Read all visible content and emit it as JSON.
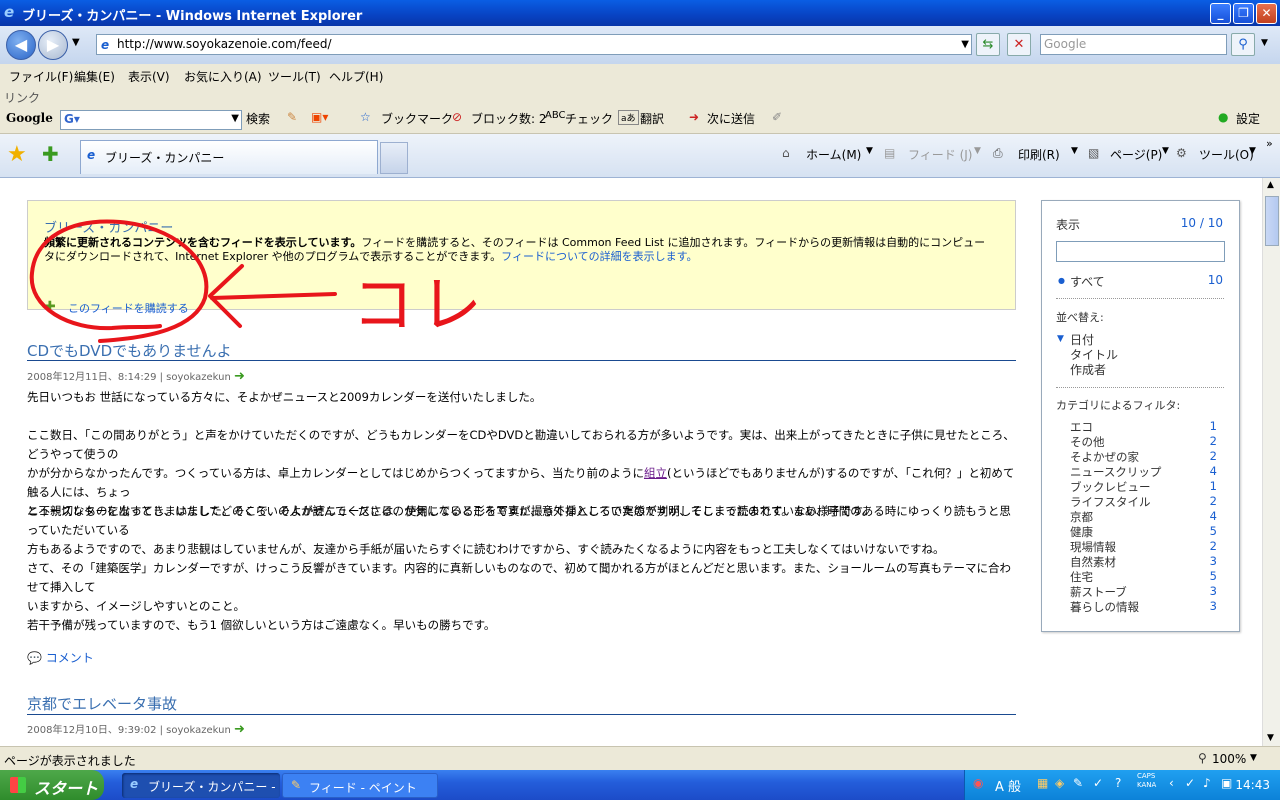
{
  "window": {
    "title": "ブリーズ・カンパニー - Windows Internet Explorer"
  },
  "address": {
    "url": "http://www.soyokazenoie.com/feed/",
    "search_placeholder": "Google"
  },
  "menu": [
    "ファイル(F)",
    "編集(E)",
    "表示(V)",
    "お気に入り(A)",
    "ツール(T)",
    "ヘルプ(H)"
  ],
  "links_label": "リンク",
  "google_toolbar": {
    "logo": "Google",
    "search_label": "検索",
    "bookmark_label": "ブックマーク",
    "block_label": "ブロック数: 2",
    "check_label": "チェック",
    "translate_label": "翻訳",
    "send_label": "次に送信",
    "settings_label": "設定"
  },
  "tabs": {
    "active_title": "ブリーズ・カンパニー"
  },
  "commands": {
    "home": "ホーム(M)",
    "feed": "フィード (J)",
    "print": "印刷(R)",
    "page": "ページ(P)",
    "tools": "ツール(O)"
  },
  "feed": {
    "name": "ブリーズ・カンパニー",
    "notice_bold": "頻繁に更新されるコンテンツを含むフィードを表示しています。",
    "notice_line1": "フィードを購読すると、そのフィードは Common Feed List に追加されます。フィードからの更新情報は自動的にコンピュー",
    "notice_line2": "タにダウンロードされて、Internet Explorer や他のプログラムで表示することができます。",
    "notice_link": "フィードについての詳細を表示します。",
    "subscribe": "このフィードを購読する"
  },
  "annotation": {
    "label": "コレ"
  },
  "entry1": {
    "title": "CDでもDVDでもありませんよ",
    "meta": "2008年12月11日、8:14:29 | soyokazekun",
    "p1": "先日いつもお 世話になっている方々に、そよかぜニュースと2009カレンダーを送付いたしました。",
    "p2a": "ここ数日、「この間ありがとう」と声をかけていただくのですが、どうもカレンダーをCDやDVDと勘違いしておられる方が多いようです。実は、出来上がってきたときに子供に見せたところ、どうやって使うの",
    "p2b": "かが分からなかったんです。つくっている方は、卓上カレンダーとしてはじめからつくってますから、当たり前のように",
    "p2link": "組立",
    "p2c": "(というほどでもありませんが)するのですが、「これ何？」と初めて触る人には、ちょっ",
    "p2d": "と不親切なものになってしまいました。そこで、そよかぜニュースには、使用している形を写真に撮って挿入していたのですが、そこまで読まれていない様子です。",
    "p3a": "ニュースレターを出すとき、はたしてどのくらいの人が読んでくださるのか気になるところですが、意外なところで実態が判明してしまったのです。まあ、時間のある時にゆっくり読もうと思っていただいている",
    "p3b": "方もあるようですので、あまり悲観はしていませんが、友達から手紙が届いたらすぐに読むわけですから、すぐ読みたくなるように内容をもっと工夫しなくてはいけないですね。",
    "p4a": "さて、その「建築医学」カレンダーですが、けっこう反響がきています。内容的に真新しいものなので、初めて聞かれる方がほとんどだと思います。また、ショールームの写真もテーマに合わせて挿入して",
    "p4b": "いますから、イメージしやすいとのこと。",
    "p5": "若干予備が残っていますので、もう1 個欲しいという方はご遠慮なく。早いもの勝ちです。",
    "comment": "コメント"
  },
  "entry2": {
    "title": "京都でエレベータ事故",
    "meta": "2008年12月10日、9:39:02 | soyokazekun"
  },
  "sidebar": {
    "display_label": "表示",
    "display_count": "10 / 10",
    "all_label": "すべて",
    "all_count": "10",
    "sort_label": "並べ替え:",
    "sort_items": [
      "日付",
      "タイトル",
      "作成者"
    ],
    "filter_label": "カテゴリによるフィルタ:",
    "categories": [
      {
        "name": "エコ",
        "count": "1"
      },
      {
        "name": "その他",
        "count": "2"
      },
      {
        "name": "そよかぜの家",
        "count": "2"
      },
      {
        "name": "ニュースクリップ",
        "count": "4"
      },
      {
        "name": "ブックレビュー",
        "count": "1"
      },
      {
        "name": "ライフスタイル",
        "count": "2"
      },
      {
        "name": "京都",
        "count": "4"
      },
      {
        "name": "健康",
        "count": "5"
      },
      {
        "name": "現場情報",
        "count": "2"
      },
      {
        "name": "自然素材",
        "count": "3"
      },
      {
        "name": "住宅",
        "count": "5"
      },
      {
        "name": "薪ストーブ",
        "count": "3"
      },
      {
        "name": "暮らしの情報",
        "count": "3"
      }
    ]
  },
  "status": {
    "text": "ページが表示されました",
    "zoom": "100%"
  },
  "taskbar": {
    "start": "スタート",
    "task1": "ブリーズ・カンパニー - ...",
    "task2": "フィード - ペイント",
    "ime": "A 般",
    "caps": "CAPS",
    "kana": "KANA",
    "clock": "14:43"
  },
  "colors": {
    "annotation_red": "#e8151b",
    "link_blue": "#1a5fd0",
    "notice_bg": "#ffffcc"
  }
}
